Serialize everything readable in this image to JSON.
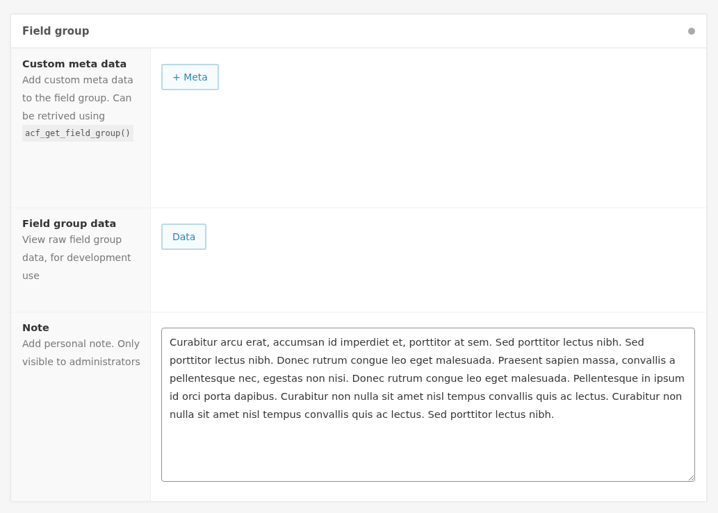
{
  "panel": {
    "title": "Field group"
  },
  "fields": [
    {
      "kind": "button",
      "label": "Custom meta data",
      "description": "Add custom meta data to the field group. Can be retrived using",
      "code": "acf_get_field_group()",
      "button": "+ Meta"
    },
    {
      "kind": "button",
      "label": "Field group data",
      "description": "View raw field group data, for development use",
      "button": "Data"
    },
    {
      "kind": "textarea",
      "label": "Note",
      "description": "Add personal note. Only visible to administrators",
      "value": "Curabitur arcu erat, accumsan id imperdiet et, porttitor at sem. Sed porttitor lectus nibh. Sed porttitor lectus nibh. Donec rutrum congue leo eget malesuada. Praesent sapien massa, convallis a pellentesque nec, egestas non nisi. Donec rutrum congue leo eget malesuada. Pellentesque in ipsum id orci porta dapibus. Curabitur non nulla sit amet nisl tempus convallis quis ac lectus. Curabitur non nulla sit amet nisl tempus convallis quis ac lectus. Sed porttitor lectus nibh."
    }
  ]
}
